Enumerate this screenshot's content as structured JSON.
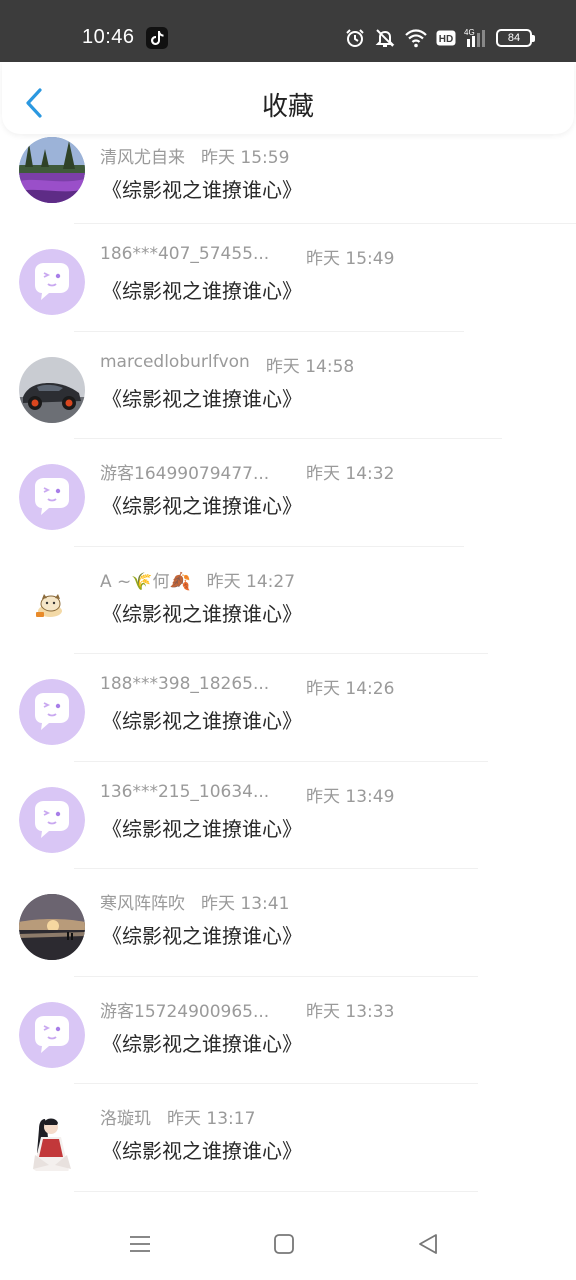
{
  "status_bar": {
    "time": "10:46",
    "battery": "84",
    "network_label": "HD",
    "signal_label": "4G",
    "icons": [
      "tiktok-icon",
      "alarm-icon",
      "mute-icon",
      "wifi-icon",
      "hd-icon",
      "signal-icon",
      "battery-icon"
    ]
  },
  "header": {
    "title": "收藏",
    "back_icon": "back-arrow-icon",
    "accent_color": "#2b98e0"
  },
  "items": [
    {
      "username": "清风尤自来",
      "time": "昨天 15:59",
      "content": "《综影视之谁撩谁心》",
      "avatar": "photo-lavender-field"
    },
    {
      "username": "186***407_57455...",
      "time": "昨天 15:49",
      "content": "《综影视之谁撩谁心》",
      "avatar": "default-chat-bubble"
    },
    {
      "username": "marcedloburlfvon",
      "time": "昨天 14:58",
      "content": "《综影视之谁撩谁心》",
      "avatar": "photo-sports-car"
    },
    {
      "username": "游客16499079477...",
      "time": "昨天 14:32",
      "content": "《综影视之谁撩谁心》",
      "avatar": "default-chat-bubble"
    },
    {
      "username": "A ~🌾何🍂",
      "time": "昨天 14:27",
      "content": "《综影视之谁撩谁心》",
      "avatar": "photo-cartoon-cat"
    },
    {
      "username": "188***398_18265...",
      "time": "昨天 14:26",
      "content": "《综影视之谁撩谁心》",
      "avatar": "default-chat-bubble"
    },
    {
      "username": "136***215_10634...",
      "time": "昨天 13:49",
      "content": "《综影视之谁撩谁心》",
      "avatar": "default-chat-bubble"
    },
    {
      "username": "寒风阵阵吹",
      "time": "昨天 13:41",
      "content": "《综影视之谁撩谁心》",
      "avatar": "photo-sunset-beach"
    },
    {
      "username": "游客15724900965...",
      "time": "昨天 13:33",
      "content": "《综影视之谁撩谁心》",
      "avatar": "default-chat-bubble"
    },
    {
      "username": "洛璇玑",
      "time": "昨天 13:17",
      "content": "《综影视之谁撩谁心》",
      "avatar": "photo-anime-character"
    }
  ],
  "nav_bar": {
    "icons": [
      "menu-icon",
      "home-square-icon",
      "back-triangle-icon"
    ]
  },
  "colors": {
    "status_bar_bg": "#3c3c3c",
    "default_avatar_bg": "#d9c6f5",
    "meta_text": "#9a9a9a",
    "content_text": "#2a2a2a"
  }
}
